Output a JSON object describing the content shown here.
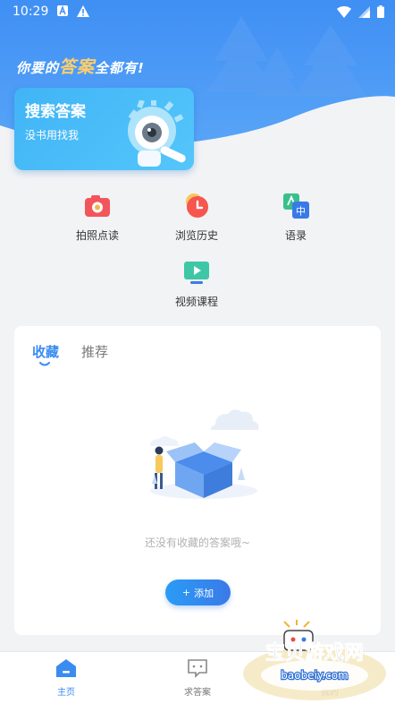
{
  "status_bar": {
    "time": "10:29"
  },
  "header": {
    "slogan_pre": "你要的",
    "slogan_accent": "答案",
    "slogan_post": "全都有!"
  },
  "search_card": {
    "title": "搜索答案",
    "subtitle": "没书用找我"
  },
  "functions": [
    {
      "label": "拍照点读",
      "icon": "camera-icon"
    },
    {
      "label": "浏览历史",
      "icon": "history-clock-icon"
    },
    {
      "label": "语录",
      "icon": "translate-icon"
    },
    {
      "label": "视频课程",
      "icon": "video-play-icon"
    }
  ],
  "panel": {
    "tabs": [
      {
        "label": "收藏",
        "active": true
      },
      {
        "label": "推荐",
        "active": false
      }
    ],
    "empty_text": "还没有收藏的答案哦~",
    "add_button": {
      "plus": "+",
      "label": "添加"
    }
  },
  "bottom_nav": [
    {
      "label": "主页",
      "active": true
    },
    {
      "label": "求答案",
      "active": false
    },
    {
      "label": "我的",
      "active": false
    }
  ],
  "watermark": {
    "title": "宝贝游戏网",
    "url": "baobeiy.com"
  },
  "colors": {
    "accent": "#3a8cf0",
    "header_blue": "#3f8ff4",
    "camera_red": "#f2565b",
    "history_red": "#f5564e"
  }
}
